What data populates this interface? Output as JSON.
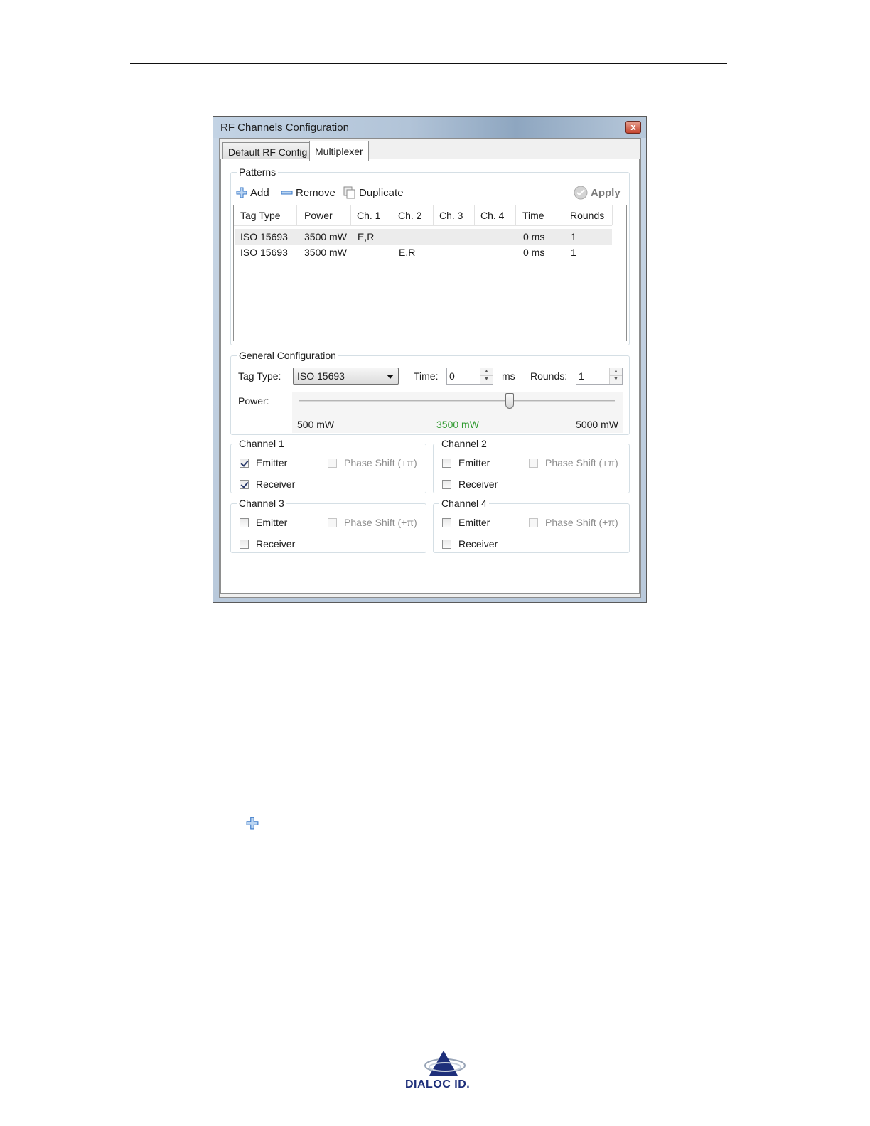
{
  "window": {
    "title": "RF Channels Configuration",
    "close_label": "x"
  },
  "tabs": [
    {
      "label": "Default RF Config",
      "active": false
    },
    {
      "label": "Multiplexer",
      "active": true
    }
  ],
  "patterns": {
    "legend": "Patterns",
    "toolbar": {
      "add_label": "Add",
      "remove_label": "Remove",
      "duplicate_label": "Duplicate",
      "apply_label": "Apply"
    },
    "columns": [
      "Tag Type",
      "Power",
      "Ch. 1",
      "Ch. 2",
      "Ch. 3",
      "Ch. 4",
      "Time",
      "Rounds"
    ],
    "rows": [
      {
        "tag_type": "ISO 15693",
        "power": "3500 mW",
        "ch1": "E,R",
        "ch2": "",
        "ch3": "",
        "ch4": "",
        "time": "0 ms",
        "rounds": "1",
        "selected": true
      },
      {
        "tag_type": "ISO 15693",
        "power": "3500 mW",
        "ch1": "",
        "ch2": "E,R",
        "ch3": "",
        "ch4": "",
        "time": "0 ms",
        "rounds": "1",
        "selected": false
      }
    ]
  },
  "general": {
    "legend": "General Configuration",
    "tag_type_label": "Tag Type:",
    "tag_type_value": "ISO 15693",
    "time_label": "Time:",
    "time_value": "0",
    "time_unit": "ms",
    "rounds_label": "Rounds:",
    "rounds_value": "1",
    "power_label": "Power:",
    "power_min_label": "500 mW",
    "power_current_label": "3500 mW",
    "power_max_label": "5000 mW",
    "power_min": 500,
    "power_max": 5000,
    "power_value": 3500
  },
  "channels": [
    {
      "legend": "Channel 1",
      "emitter_label": "Emitter",
      "emitter": true,
      "receiver_label": "Receiver",
      "receiver": true,
      "phase_label": "Phase Shift (+π)",
      "phase": false
    },
    {
      "legend": "Channel 2",
      "emitter_label": "Emitter",
      "emitter": false,
      "receiver_label": "Receiver",
      "receiver": false,
      "phase_label": "Phase Shift (+π)",
      "phase": false
    },
    {
      "legend": "Channel 3",
      "emitter_label": "Emitter",
      "emitter": false,
      "receiver_label": "Receiver",
      "receiver": false,
      "phase_label": "Phase Shift (+π)",
      "phase": false
    },
    {
      "legend": "Channel 4",
      "emitter_label": "Emitter",
      "emitter": false,
      "receiver_label": "Receiver",
      "receiver": false,
      "phase_label": "Phase Shift (+π)",
      "phase": false
    }
  ],
  "footer": {
    "logo_text": "DIALOC ID."
  },
  "colors": {
    "accent_blue": "#3a78c8",
    "power_current": "#2e9a2e"
  }
}
